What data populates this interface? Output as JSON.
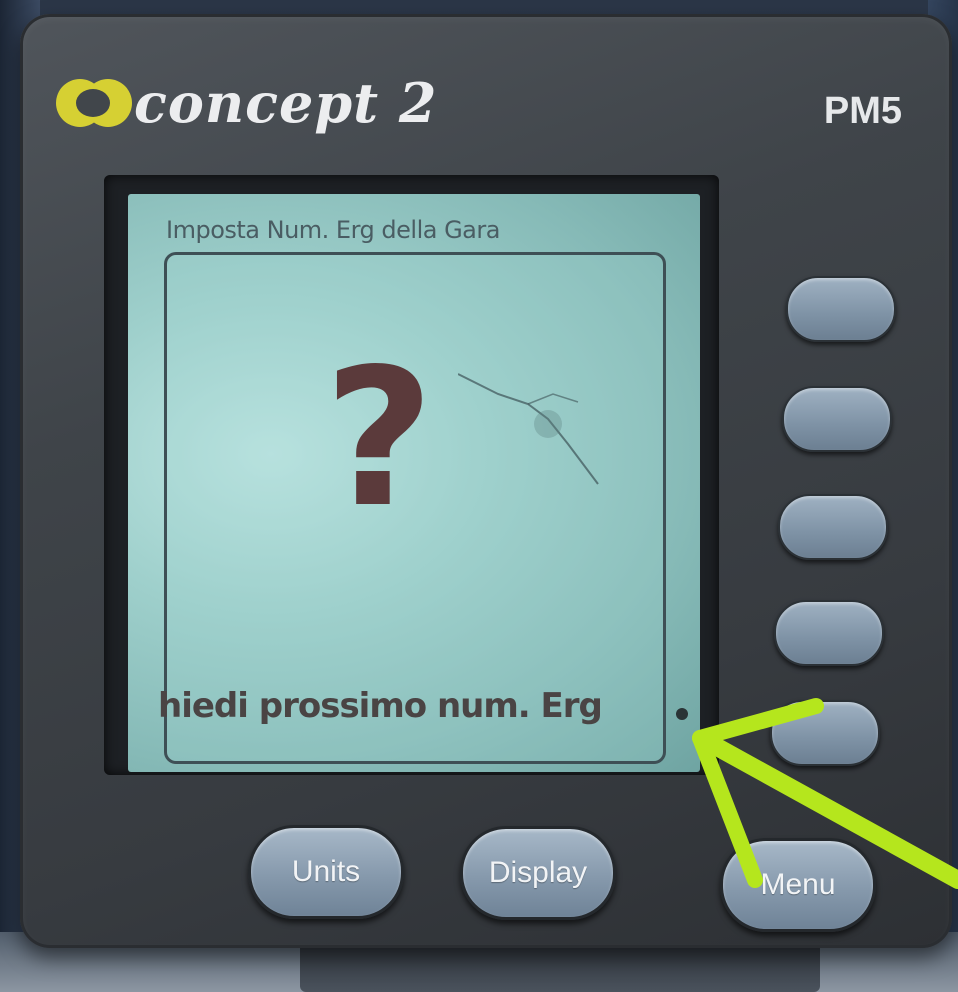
{
  "brand": {
    "name": "concept 2",
    "model": "PM5"
  },
  "screen": {
    "header": "Imposta Num. Erg della Gara",
    "symbol": "?",
    "footer": "hiedi prossimo num. Erg"
  },
  "side_buttons": [
    "",
    "",
    "",
    "",
    ""
  ],
  "bottom_buttons": {
    "units": "Units",
    "display": "Display",
    "menu": "Menu"
  },
  "colors": {
    "logo_yellow": "#d6d033",
    "lcd": "#9fd0cc",
    "question_mark": "#5b3a3b",
    "annotation_arrow": "#b5e61d",
    "button": "#8699ac"
  },
  "annotation": {
    "type": "arrow",
    "points_to": "lcd-dot"
  }
}
